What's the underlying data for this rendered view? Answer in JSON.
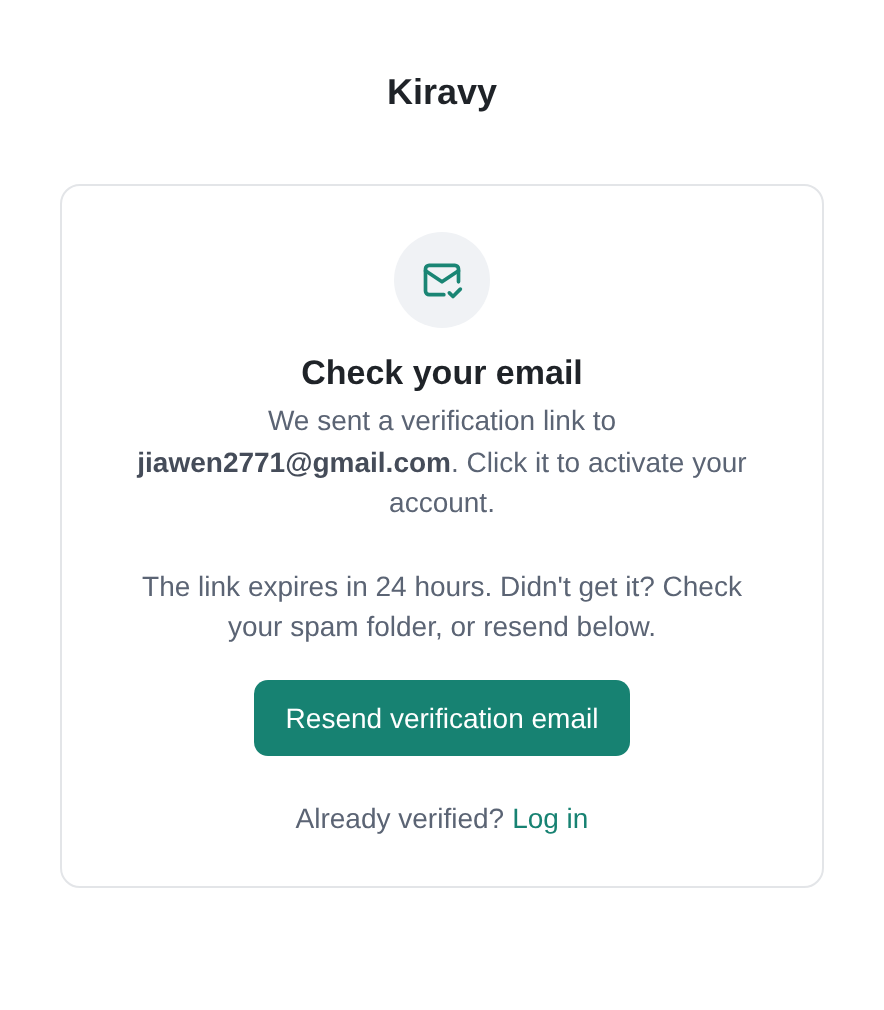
{
  "brand": "Kiravy",
  "card": {
    "heading": "Check your email",
    "message": "We sent a verification link to **jiawen2771@gmail.com**. Click it to activate your account.",
    "note": "The link expires in 24 hours. Didn't get it? Check your spam folder, or resend below.",
    "button": "Resend verification email",
    "footer_text": "Already verified?",
    "footer_link": "Log in"
  }
}
